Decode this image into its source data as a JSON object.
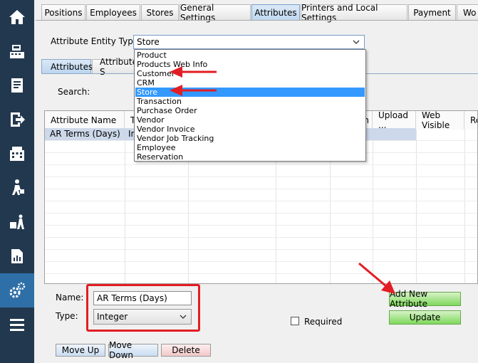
{
  "sidebar": {
    "items": [
      {
        "icon": "home-icon"
      },
      {
        "icon": "cash-register-icon"
      },
      {
        "icon": "receipt-icon"
      },
      {
        "icon": "exit-icon"
      },
      {
        "icon": "building-icon"
      },
      {
        "icon": "customer-walking-icon"
      },
      {
        "icon": "delivery-icon"
      },
      {
        "icon": "report-icon"
      },
      {
        "icon": "settings-gears-icon"
      },
      {
        "icon": "menu-icon"
      }
    ],
    "active_index": 8
  },
  "top_tabs": [
    "Positions",
    "Employees",
    "Stores",
    "General Settings",
    "Attributes",
    "Printers and Local Settings",
    "Payment",
    "Wo"
  ],
  "active_top_tab": "Attributes",
  "entity": {
    "label": "Attribute Entity Type:",
    "selected": "Store",
    "options": [
      "Product",
      "Products Web Info",
      "Customer",
      "CRM",
      "Store",
      "Transaction",
      "Purchase Order",
      "Vendor",
      "Vendor Invoice",
      "Vendor Job Tracking",
      "Employee",
      "Reservation"
    ]
  },
  "inner_tabs": [
    "Attributes",
    "Attribute S"
  ],
  "search_label": "Search:",
  "grid": {
    "columns": [
      "Attribute Name",
      "T",
      "",
      "",
      "n",
      "Upload ...",
      "Web Visible",
      "Re"
    ],
    "rows": [
      {
        "name": "AR Terms (Days)",
        "type": "In"
      }
    ]
  },
  "form": {
    "name_label": "Name:",
    "name_value": "AR Terms (Days)",
    "type_label": "Type:",
    "type_value": "Integer",
    "required_label": "Required"
  },
  "buttons": {
    "add": "Add New Attribute",
    "update": "Update",
    "move_up": "Move Up",
    "move_down": "Move Down",
    "delete": "Delete"
  },
  "colors": {
    "sidebar_bg": "#22384f",
    "sidebar_active": "#2f6fa8",
    "selection": "#3399ff",
    "annotation_red": "#e21d24",
    "add_button": "#7fd85c"
  }
}
